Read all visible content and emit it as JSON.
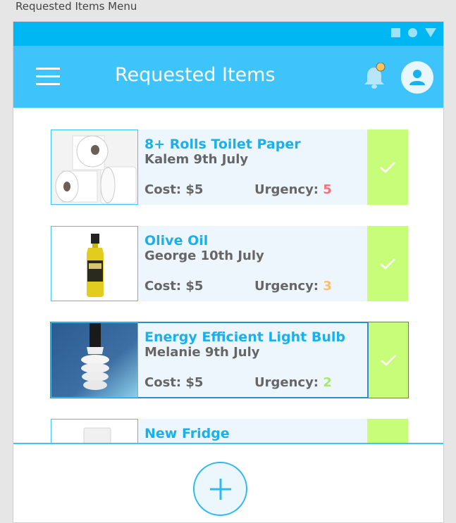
{
  "canvas_title": "Requested Items Menu",
  "app_bar": {
    "title": "Requested Items",
    "menu_icon": "hamburger-menu-icon",
    "notification_icon": "bell-icon",
    "profile_icon": "user-icon"
  },
  "colors": {
    "status_bar": "#00b7f4",
    "app_bar": "#3ec4fa",
    "item_name": "#1ab0ec",
    "accept_button": "#c7fd79",
    "urgency_high": "#f5707a",
    "urgency_medium": "#f8bf6e",
    "urgency_low": "#a6e86e"
  },
  "items": [
    {
      "name": "8+ Rolls Toilet Paper",
      "requester": "Kalem 9th July",
      "cost_label": "Cost: $5",
      "urgency_label": "Urgency: ",
      "urgency_value": "5",
      "urgency_color": "#f5707a",
      "image": "toilet-paper-image"
    },
    {
      "name": "Olive Oil",
      "requester": "George 10th July",
      "cost_label": "Cost: $5",
      "urgency_label": "Urgency: ",
      "urgency_value": "3",
      "urgency_color": "#f8bf6e",
      "image": "olive-oil-image"
    },
    {
      "name": "Energy Efficient Light Bulb",
      "requester": "Melanie 9th July",
      "cost_label": "Cost: $5",
      "urgency_label": "Urgency: ",
      "urgency_value": "2",
      "urgency_color": "#a6e86e",
      "image": "light-bulb-image"
    },
    {
      "name": "New Fridge",
      "image": "fridge-image"
    }
  ],
  "fab": {
    "icon": "plus-icon"
  }
}
